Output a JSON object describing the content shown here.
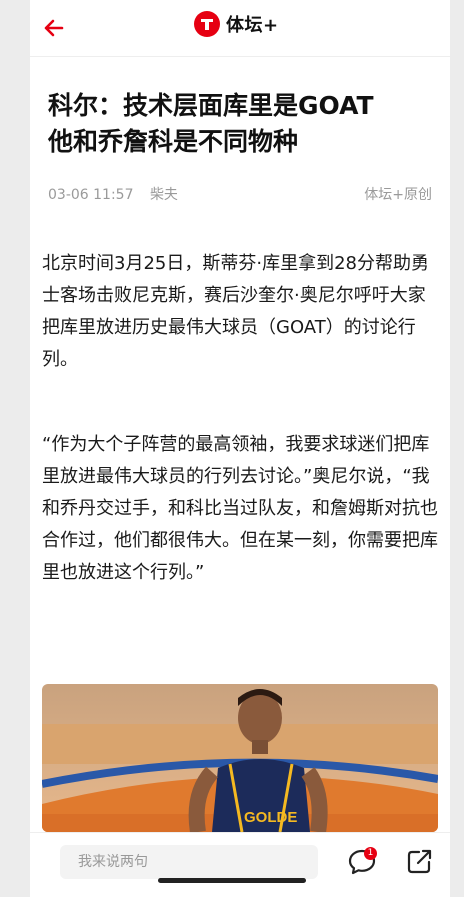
{
  "header": {
    "back_icon": "arrow-left-icon",
    "brand_logo_letter": "T",
    "brand_name": "体坛+",
    "accent_color": "#e60012"
  },
  "article": {
    "title_line1": "科尔：技术层面库里是GOAT",
    "title_line2": "他和乔詹科是不同物种",
    "date": "03-06 11:57",
    "author": "柴夫",
    "source": "体坛+原创",
    "paragraphs": [
      "北京时间3月25日，斯蒂芬·库里拿到28分帮助勇士客场击败尼克斯，赛后沙奎尔·奥尼尔呼吁大家把库里放进历史最伟大球员（GOAT）的讨论行列。",
      "“作为大个子阵营的最高领袖，我要求球迷们把库里放进最伟大球员的行列去讨论。”奥尼尔说，“我和乔丹交过手，和科比当过队友，和詹姆斯对抗也合作过，他们都很伟大。但在某一刻，你需要把库里也放进这个行列。”"
    ],
    "image_jersey_text": "GOLDE"
  },
  "footer": {
    "comment_placeholder": "我来说两句",
    "comment_count": "1",
    "comment_icon": "comment-icon",
    "share_icon": "share-icon"
  }
}
